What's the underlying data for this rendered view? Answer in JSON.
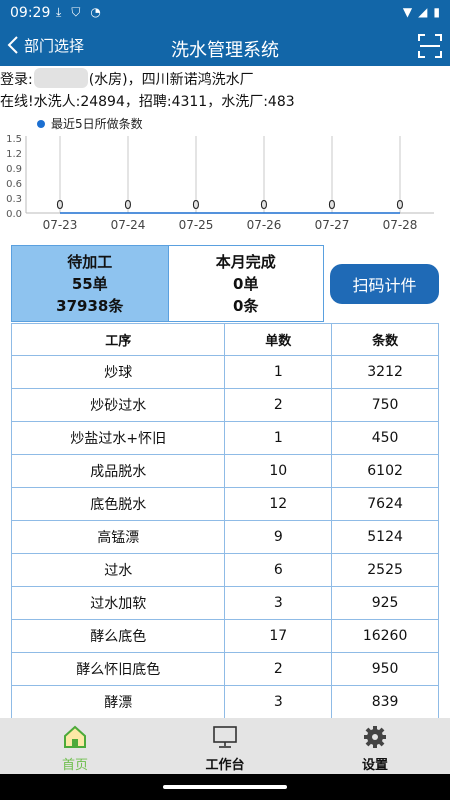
{
  "status_bar": {
    "time": "09:29",
    "left_icons": [
      "download-icon",
      "shield-icon",
      "wifi-question-icon"
    ],
    "right_icons": [
      "wifi-icon",
      "signal-icon",
      "battery-icon"
    ]
  },
  "header": {
    "back_label": "部门选择",
    "title": "洗水管理系统",
    "scan_icon": "scan-frame-icon"
  },
  "info": {
    "login_prefix": "登录:",
    "login_suffix": "(水房)，四川新诺鸿洗水厂",
    "online_line": "在线!水洗人:24894，招聘:4311，水洗厂:483"
  },
  "chart_data": {
    "type": "line",
    "legend": "最近5日所做条数",
    "legend_placement": "top-left",
    "categories": [
      "07-23",
      "07-24",
      "07-25",
      "07-26",
      "07-27",
      "07-28"
    ],
    "series": [
      {
        "name": "最近5日所做条数",
        "values": [
          0,
          0,
          0,
          0,
          0,
          0
        ]
      }
    ],
    "data_labels": [
      "0",
      "0",
      "0",
      "0",
      "0",
      "0"
    ],
    "y_ticks": [
      "1.5",
      "1.2",
      "0.9",
      "0.6",
      "0.3",
      "0.0"
    ],
    "ylim": [
      0,
      1.5
    ],
    "grid": "vertical",
    "color": "#1c6fd1"
  },
  "summary": {
    "pending_title": "待加工",
    "pending_orders": "55单",
    "pending_pieces": "37938条",
    "month_title": "本月完成",
    "month_orders": "0单",
    "month_pieces": "0条"
  },
  "scan_button": "扫码计件",
  "table": {
    "headers": [
      "工序",
      "单数",
      "条数"
    ],
    "rows": [
      [
        "炒球",
        "1",
        "3212"
      ],
      [
        "炒砂过水",
        "2",
        "750"
      ],
      [
        "炒盐过水+怀旧",
        "1",
        "450"
      ],
      [
        "成品脱水",
        "10",
        "6102"
      ],
      [
        "底色脱水",
        "12",
        "7624"
      ],
      [
        "高锰漂",
        "9",
        "5124"
      ],
      [
        "过水",
        "6",
        "2525"
      ],
      [
        "过水加软",
        "3",
        "925"
      ],
      [
        "酵么底色",
        "17",
        "16260"
      ],
      [
        "酵么怀旧底色",
        "2",
        "950"
      ],
      [
        "酵漂",
        "3",
        "839"
      ]
    ]
  },
  "nav": {
    "home": "首页",
    "workbench": "工作台",
    "settings": "设置"
  },
  "colors": {
    "header": "#1266a8",
    "accent": "#1f6ab6",
    "pending_bg": "#8ec3ef",
    "nav_active": "#6fbf4d"
  }
}
